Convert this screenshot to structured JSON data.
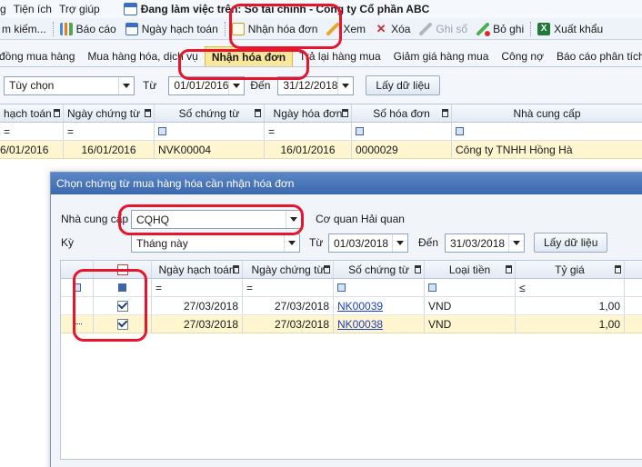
{
  "menu": {
    "items": [
      "Tiện ích",
      "Trợ giúp"
    ],
    "partial_item": "g",
    "workspace_text": "Đang làm việc trên: Sổ tài chính - Công ty Cổ phần ABC"
  },
  "toolbar": {
    "search": "m kiếm...",
    "report": "Báo cáo",
    "posting_date": "Ngày hạch toán",
    "receive_invoice": "Nhận hóa đơn",
    "view": "Xem",
    "delete": "Xóa",
    "post": "Ghi sổ",
    "unpost": "Bỏ ghi",
    "export": "Xuất khẩu"
  },
  "tabs": [
    "đồng mua hàng",
    "Mua hàng hóa, dịch vụ",
    "Nhận hóa đơn",
    "Trả lại hàng mua",
    "Giảm giá hàng mua",
    "Công nợ",
    "Báo cáo phân tích"
  ],
  "filter": {
    "period_value": "Tùy chọn",
    "from_label": "Từ",
    "from_value": "01/01/2016",
    "to_label": "Đến",
    "to_value": "31/12/2018",
    "fetch_button": "Lấy dữ liệu"
  },
  "main_grid": {
    "columns": [
      "hạch toán",
      "Ngày chứng từ",
      "Số chứng từ",
      "Ngày hóa đơn",
      "Số hóa đơn",
      "Nhà cung cấp"
    ],
    "filter_ops": [
      "=",
      "=",
      "",
      "=",
      "",
      ""
    ],
    "rows": [
      [
        "6/01/2016",
        "16/01/2016",
        "NVK00004",
        "16/01/2016",
        "0000029",
        "Công ty TNHH Hồng Hà"
      ]
    ]
  },
  "dialog": {
    "title": "Chọn chứng từ mua hàng hóa cần nhận hóa đơn",
    "supplier_label": "Nhà cung cấp",
    "supplier_value": "CQHQ",
    "supplier_name": "Cơ quan Hải quan",
    "period_label": "Kỳ",
    "period_value": "Tháng này",
    "from_label": "Từ",
    "from_value": "01/03/2018",
    "to_label": "Đến",
    "to_value": "31/03/2018",
    "fetch_button": "Lấy dữ liệu",
    "grid": {
      "columns": [
        "Ngày hạch toán",
        "Ngày chứng từ",
        "Số chứng từ",
        "Loại tiền",
        "Tỷ giá"
      ],
      "filter_ops": [
        "=",
        "=",
        "",
        "",
        "≤"
      ],
      "rows": [
        {
          "checked": true,
          "posting_date": "27/03/2018",
          "doc_date": "27/03/2018",
          "doc_no": "NK00039",
          "currency": "VND",
          "rate": "1,00"
        },
        {
          "checked": true,
          "posting_date": "27/03/2018",
          "doc_date": "27/03/2018",
          "doc_no": "NK00038",
          "currency": "VND",
          "rate": "1,00"
        }
      ]
    }
  },
  "colors": {
    "active_tab": "#fbe79a",
    "dialog_title": "#3a68ad",
    "annotation": "#e8142b",
    "link": "#1a3fc4"
  }
}
